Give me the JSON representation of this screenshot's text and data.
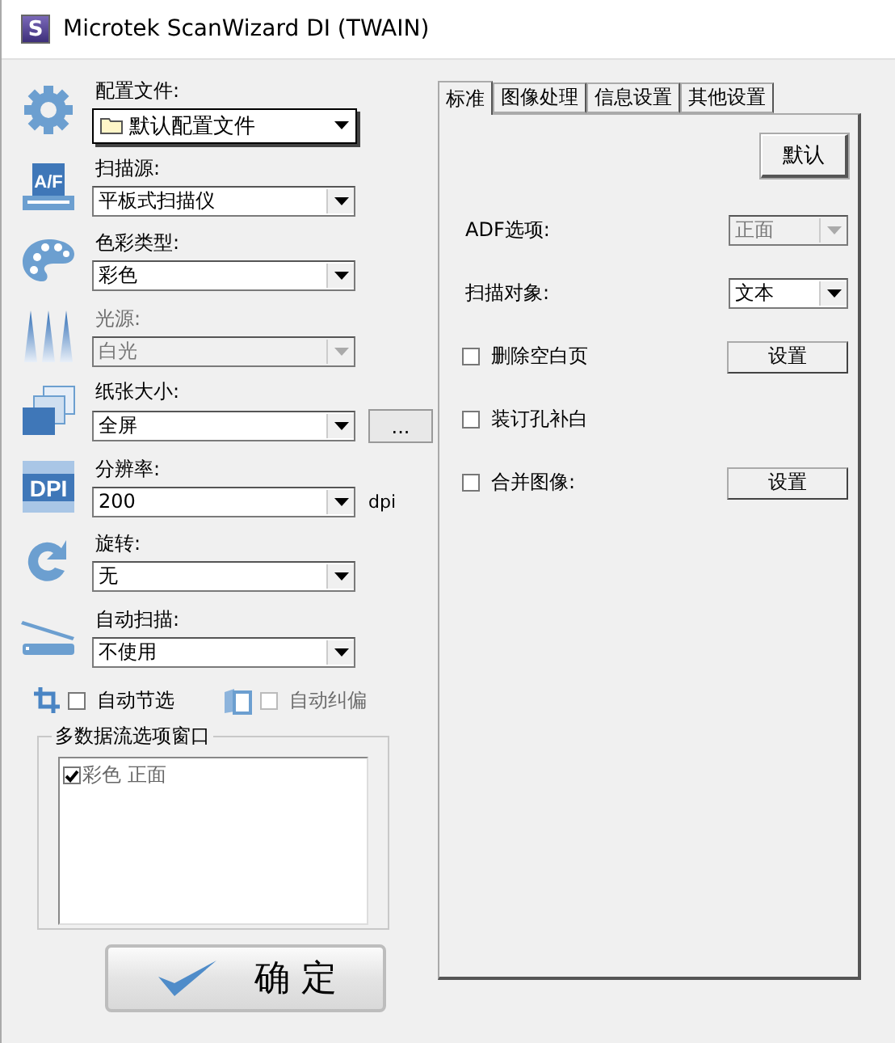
{
  "window": {
    "title": "Microtek ScanWizard DI (TWAIN)",
    "app_icon_letter": "S"
  },
  "left": {
    "rows": [
      {
        "kind": "profile",
        "label": "配置文件:",
        "value": "默认配置文件"
      },
      {
        "kind": "select",
        "label": "扫描源:",
        "value": "平板式扫描仪",
        "disabled": false,
        "icon_text": "A/F"
      },
      {
        "kind": "select",
        "label": "色彩类型:",
        "value": "彩色",
        "disabled": false
      },
      {
        "kind": "select",
        "label": "光源:",
        "value": "白光",
        "disabled": true
      },
      {
        "kind": "select",
        "label": "纸张大小:",
        "value": "全屏",
        "disabled": false,
        "button": "..."
      },
      {
        "kind": "select",
        "label": "分辨率:",
        "value": "200",
        "disabled": false,
        "unit": "dpi",
        "icon_text": "DPI"
      },
      {
        "kind": "select",
        "label": "旋转:",
        "value": "无",
        "disabled": false
      },
      {
        "kind": "select",
        "label": "自动扫描:",
        "value": "不使用",
        "disabled": false
      }
    ],
    "options": [
      {
        "label": "自动节选",
        "checked": false,
        "disabled": false
      },
      {
        "label": "自动纠偏",
        "checked": false,
        "disabled": true
      }
    ],
    "group": {
      "title": "多数据流选项窗口",
      "items": [
        {
          "label": "彩色 正面",
          "checked": true
        }
      ]
    },
    "ok_button": "确 定"
  },
  "right": {
    "tabs": [
      {
        "label": "标准",
        "selected": true
      },
      {
        "label": "图像处理",
        "selected": false
      },
      {
        "label": "信息设置",
        "selected": false
      },
      {
        "label": "其他设置",
        "selected": false
      }
    ],
    "default_button": "默认",
    "rows": [
      {
        "kind": "select",
        "label": "ADF选项:",
        "value": "正面",
        "disabled": true
      },
      {
        "kind": "select",
        "label": "扫描对象:",
        "value": "文本",
        "disabled": false
      },
      {
        "kind": "checkbox",
        "label": "删除空白页",
        "checked": false,
        "button": "设置"
      },
      {
        "kind": "checkbox",
        "label": "装订孔补白",
        "checked": false
      },
      {
        "kind": "checkbox",
        "label": "合并图像:",
        "checked": false,
        "button": "设置"
      }
    ]
  }
}
